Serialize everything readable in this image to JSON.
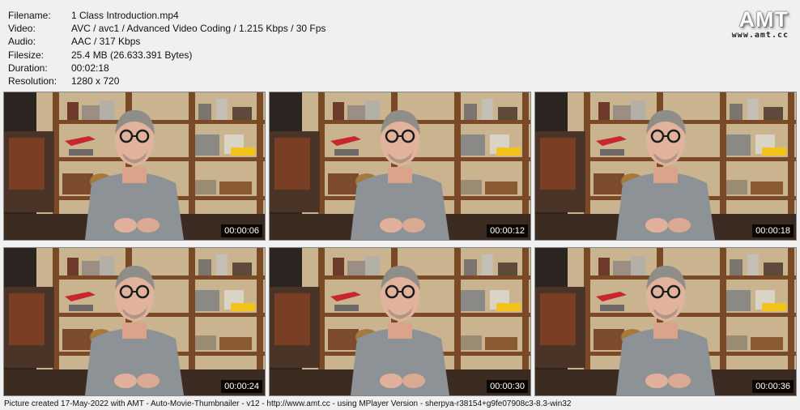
{
  "info": [
    {
      "label": "Filename:",
      "value": "1 Class Introduction.mp4"
    },
    {
      "label": "Video:",
      "value": "AVC / avc1 / Advanced Video Coding / 1.215 Kbps / 30 Fps"
    },
    {
      "label": "Audio:",
      "value": "AAC / 317 Kbps"
    },
    {
      "label": "Filesize:",
      "value": "25.4 MB (26.633.391 Bytes)"
    },
    {
      "label": "Duration:",
      "value": "00:02:18"
    },
    {
      "label": "Resolution:",
      "value": "1280 x 720"
    }
  ],
  "logo": {
    "mark": "AMT",
    "url": "www.amt.cc"
  },
  "thumbnails": [
    {
      "time": "00:00:06"
    },
    {
      "time": "00:00:12"
    },
    {
      "time": "00:00:18"
    },
    {
      "time": "00:00:24"
    },
    {
      "time": "00:00:30"
    },
    {
      "time": "00:00:36"
    }
  ],
  "footer": "Picture created 17-May-2022 with AMT - Auto-Movie-Thumbnailer - v12 - http://www.amt.cc - using MPlayer Version - sherpya-r38154+g9fe07908c3-8.3-win32",
  "colors": {
    "shirt": "#8d9296",
    "shelf": "#7a4a26",
    "wall": "#c9b48f",
    "background": "#f0f0f0"
  }
}
